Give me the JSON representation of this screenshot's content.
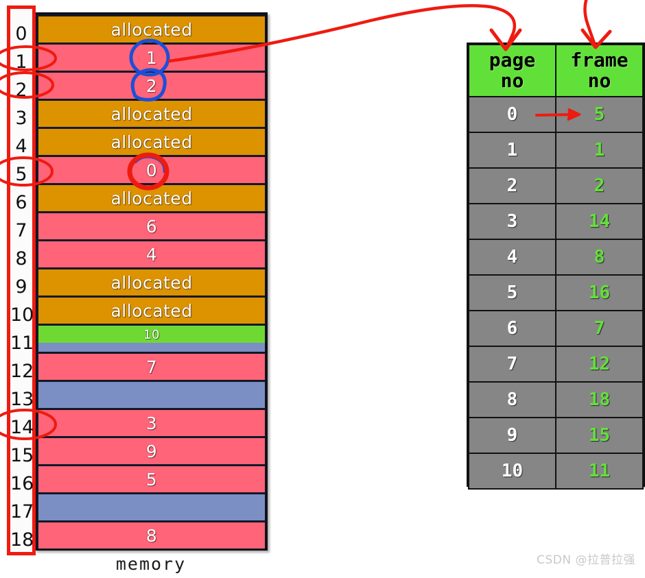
{
  "memory": {
    "caption": "memory",
    "index_labels": [
      "0",
      "1",
      "2",
      "3",
      "4",
      "5",
      "6",
      "7",
      "8",
      "9",
      "10",
      "11",
      "12",
      "13",
      "14",
      "15",
      "16",
      "17",
      "18"
    ],
    "allocated_label": "allocated",
    "colors": {
      "allocated": "#dd9200",
      "free_page": "#ff6478",
      "green_band": "#6fd933",
      "blue_band": "#7b8fc4",
      "border": "#0d1017",
      "index_border": "#ee1b11"
    },
    "rows": [
      {
        "index": "0",
        "kind": "allocated",
        "label": "allocated"
      },
      {
        "index": "1",
        "kind": "page",
        "label": "1"
      },
      {
        "index": "2",
        "kind": "page",
        "label": "2"
      },
      {
        "index": "3",
        "kind": "allocated",
        "label": "allocated"
      },
      {
        "index": "4",
        "kind": "allocated",
        "label": "allocated"
      },
      {
        "index": "5",
        "kind": "page",
        "label": "0"
      },
      {
        "index": "6",
        "kind": "allocated",
        "label": "allocated"
      },
      {
        "index": "7",
        "kind": "page",
        "label": "6"
      },
      {
        "index": "8",
        "kind": "page",
        "label": "4"
      },
      {
        "index": "9",
        "kind": "allocated",
        "label": "allocated"
      },
      {
        "index": "10",
        "kind": "allocated",
        "label": "allocated"
      },
      {
        "index": "11",
        "kind": "green",
        "label": "10"
      },
      {
        "index": "12",
        "kind": "page",
        "label": "7"
      },
      {
        "index": "13",
        "kind": "blue",
        "label": ""
      },
      {
        "index": "14",
        "kind": "page",
        "label": "3"
      },
      {
        "index": "15",
        "kind": "page",
        "label": "9"
      },
      {
        "index": "16",
        "kind": "page",
        "label": "5"
      },
      {
        "index": "17",
        "kind": "blue",
        "label": ""
      },
      {
        "index": "18",
        "kind": "page",
        "label": "8"
      }
    ]
  },
  "page_table": {
    "headers": {
      "page_no": "page\nno",
      "frame_no": "frame\nno"
    },
    "header_page_line1": "page",
    "header_page_line2": "no",
    "header_frame_line1": "frame",
    "header_frame_line2": "no",
    "rows": [
      {
        "page_no": "0",
        "frame_no": "5"
      },
      {
        "page_no": "1",
        "frame_no": "1"
      },
      {
        "page_no": "2",
        "frame_no": "2"
      },
      {
        "page_no": "3",
        "frame_no": "14"
      },
      {
        "page_no": "4",
        "frame_no": "8"
      },
      {
        "page_no": "5",
        "frame_no": "16"
      },
      {
        "page_no": "6",
        "frame_no": "7"
      },
      {
        "page_no": "7",
        "frame_no": "12"
      },
      {
        "page_no": "8",
        "frame_no": "18"
      },
      {
        "page_no": "9",
        "frame_no": "15"
      },
      {
        "page_no": "10",
        "frame_no": "11"
      }
    ],
    "colors": {
      "header_bg": "#62e03a",
      "cell_bg": "#868686",
      "frame_text": "#62e03a",
      "page_text": "#ffffff"
    }
  },
  "annotations": {
    "color_red": "#ee1b11",
    "color_blue": "#1c4fd8",
    "circled_memory_values": [
      "1",
      "2",
      "0"
    ],
    "circled_index_rows": [
      "1",
      "2",
      "5",
      "14"
    ],
    "red_circled_value": "0",
    "arrow_targets": [
      "page no",
      "frame no"
    ]
  },
  "watermark": {
    "text": "CSDN @拉普拉强"
  }
}
